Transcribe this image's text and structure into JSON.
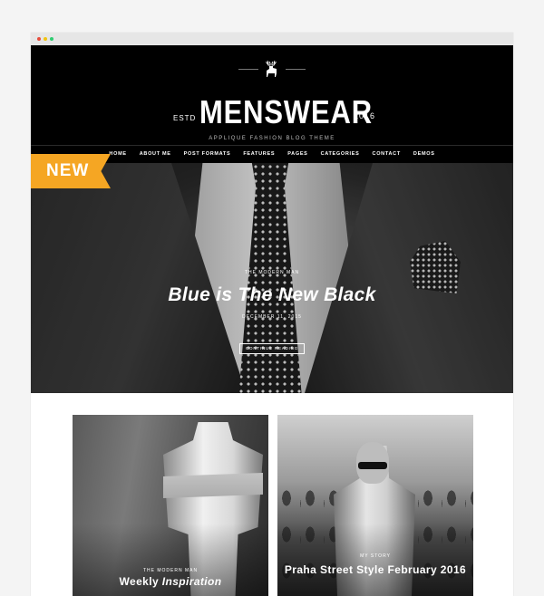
{
  "masthead": {
    "estd": "ESTD",
    "brand": "MENSWEAR",
    "year": "2016",
    "tagline": "APPLIQUE FASHION BLOG THEME",
    "logo_icon": "deer-icon"
  },
  "nav": {
    "items": [
      "HOME",
      "ABOUT ME",
      "POST FORMATS",
      "FEATURES",
      "PAGES",
      "CATEGORIES",
      "CONTACT",
      "DEMOS"
    ]
  },
  "badge": {
    "label": "NEW",
    "color": "#f5a623"
  },
  "slider": {
    "category": "THE MODERN MAN",
    "title": "Blue is The New Black",
    "date": "DECEMBER 11, 2015",
    "button": "CONTINUE READING",
    "dots_total": 9,
    "active_dot": 5
  },
  "cards": [
    {
      "category": "THE MODERN MAN",
      "title_a": "Weekly ",
      "title_b": "Inspiration"
    },
    {
      "category": "MY STORY",
      "title_a": "Praha Street Style February 2016",
      "title_b": ""
    }
  ]
}
